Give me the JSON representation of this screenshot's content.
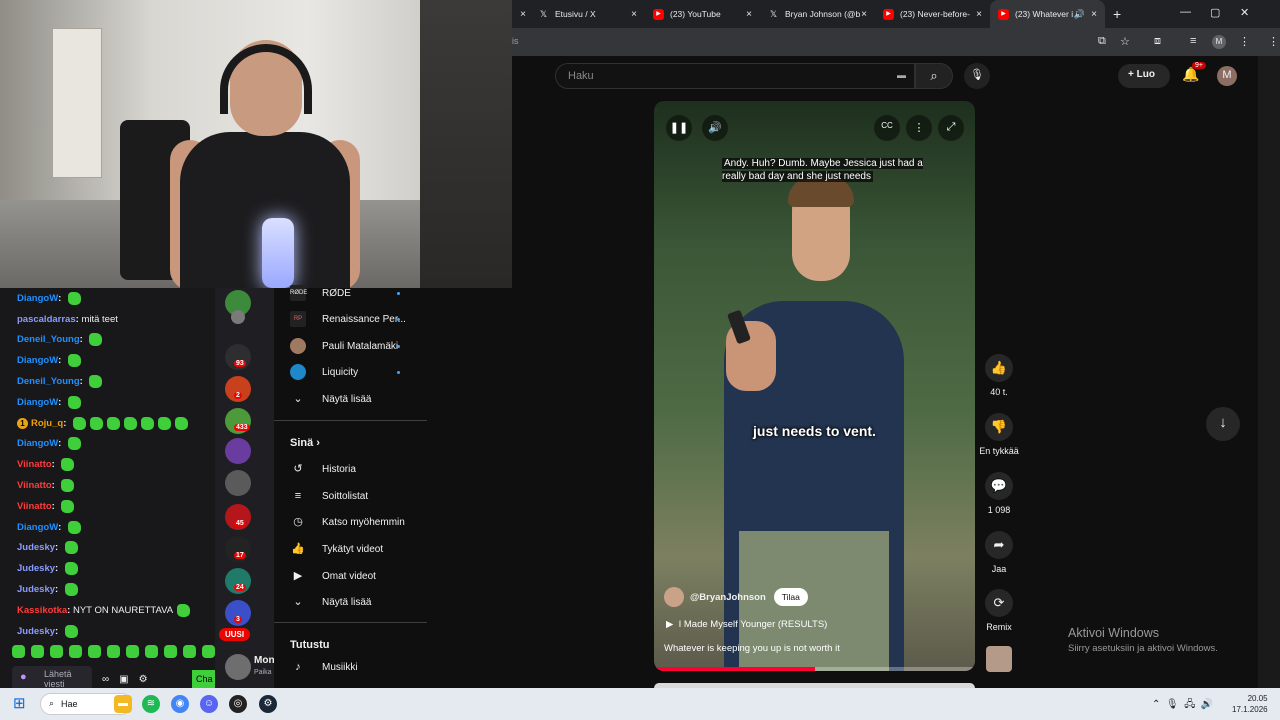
{
  "tabs": [
    {
      "title": "Etusivu / X",
      "icon": "x-icon"
    },
    {
      "title": "(23) YouTube",
      "icon": "youtube-icon"
    },
    {
      "title": "Bryan Johnson (@b",
      "icon": "x-icon"
    },
    {
      "title": "(23) Never-before-",
      "icon": "youtube-icon"
    },
    {
      "title": "(23) Whatever i",
      "icon": "youtube-icon"
    }
  ],
  "address": {
    "url": "is"
  },
  "profile_initial": "M",
  "youtube": {
    "search_placeholder": "Haku",
    "create_label": "Luo",
    "notifications_badge": "9+",
    "avatar_initial": "M"
  },
  "short": {
    "subtitle_top": "Andy. Huh? Dumb. Maybe Jessica just had a really bad day and she just needs",
    "subtitle_main": "just needs to vent.",
    "channel": "@BryanJohnson",
    "subscribe_label": "Tilaa",
    "related": "I Made Myself Younger (RESULTS)",
    "caption": "Whatever is keeping you up is not worth it",
    "progress": 0.5
  },
  "actions": {
    "likes": "40 t.",
    "dislike": "En tykkää",
    "comments": "1 098",
    "share": "Jaa",
    "remix": "Remix"
  },
  "sidebar": {
    "subscriptions": [
      {
        "label": "RØDE",
        "icon": "rode-logo"
      },
      {
        "label": "Renaissance Per...",
        "icon": "rp-logo"
      },
      {
        "label": "Pauli Matalamäki",
        "icon": "avatar"
      },
      {
        "label": "Liquicity",
        "icon": "liquicity-logo"
      },
      {
        "label": "Näytä lisää",
        "icon": "chevron-down-icon"
      }
    ],
    "you_title": "Sinä",
    "you_items": [
      {
        "label": "Historia",
        "icon": "history-icon"
      },
      {
        "label": "Soittolistat",
        "icon": "playlist-icon"
      },
      {
        "label": "Katso myöhemmin",
        "icon": "clock-icon"
      },
      {
        "label": "Tykätyt videot",
        "icon": "thumbs-up-icon"
      },
      {
        "label": "Omat videot",
        "icon": "video-icon"
      },
      {
        "label": "Näytä lisää",
        "icon": "chevron-down-icon"
      }
    ],
    "explore_title": "Tutustu",
    "explore_items": [
      {
        "label": "Musiikki",
        "icon": "music-icon"
      }
    ]
  },
  "chat": {
    "messages": [
      {
        "user": "DiangoW",
        "color": "#1e90ff",
        "text": "",
        "emotes": 1
      },
      {
        "user": "pascaldarras",
        "color": "#8a9bff",
        "text": "mitä teet",
        "emotes": 0
      },
      {
        "user": "Deneil_Young",
        "color": "#1e90ff",
        "text": "",
        "emotes": 1
      },
      {
        "user": "DiangoW",
        "color": "#1e90ff",
        "text": "",
        "emotes": 1
      },
      {
        "user": "Deneil_Young",
        "color": "#1e90ff",
        "text": "",
        "emotes": 1
      },
      {
        "user": "DiangoW",
        "color": "#1e90ff",
        "text": "",
        "emotes": 1
      },
      {
        "user": "Roju_q",
        "color": "#f0a000",
        "text": "",
        "emotes": 7,
        "badge": true
      },
      {
        "user": "DiangoW",
        "color": "#1e90ff",
        "text": "",
        "emotes": 1
      },
      {
        "user": "Viinatto",
        "color": "#ff3b3b",
        "text": "",
        "emotes": 1
      },
      {
        "user": "Viinatto",
        "color": "#ff3b3b",
        "text": "",
        "emotes": 1
      },
      {
        "user": "Viinatto",
        "color": "#ff3b3b",
        "text": "",
        "emotes": 1
      },
      {
        "user": "DiangoW",
        "color": "#1e90ff",
        "text": "",
        "emotes": 1
      },
      {
        "user": "Judesky",
        "color": "#8a9bff",
        "text": "",
        "emotes": 1
      },
      {
        "user": "Judesky",
        "color": "#8a9bff",
        "text": "",
        "emotes": 1
      },
      {
        "user": "Judesky",
        "color": "#8a9bff",
        "text": "",
        "emotes": 1
      },
      {
        "user": "Kassikotka",
        "color": "#ff3b3b",
        "text": "NYT ON NAURETTAVA",
        "emotes": 1
      },
      {
        "user": "Judesky",
        "color": "#8a9bff",
        "text": "",
        "emotes": 1
      }
    ],
    "input_placeholder": "Lähetä viesti",
    "chat_button": "Cha"
  },
  "rail": {
    "badges": [
      "93",
      "2",
      "433",
      "45",
      "17",
      "24",
      "3"
    ],
    "new_label": "UUSI",
    "channel_label": "Mon",
    "channel_sub": "Paika"
  },
  "windows": {
    "activate_title": "Aktivoi Windows",
    "activate_sub": "Siirry asetuksiin ja aktivoi Windows.",
    "search_label": "Hae",
    "time": "20.05",
    "date": "17.1.2026"
  }
}
